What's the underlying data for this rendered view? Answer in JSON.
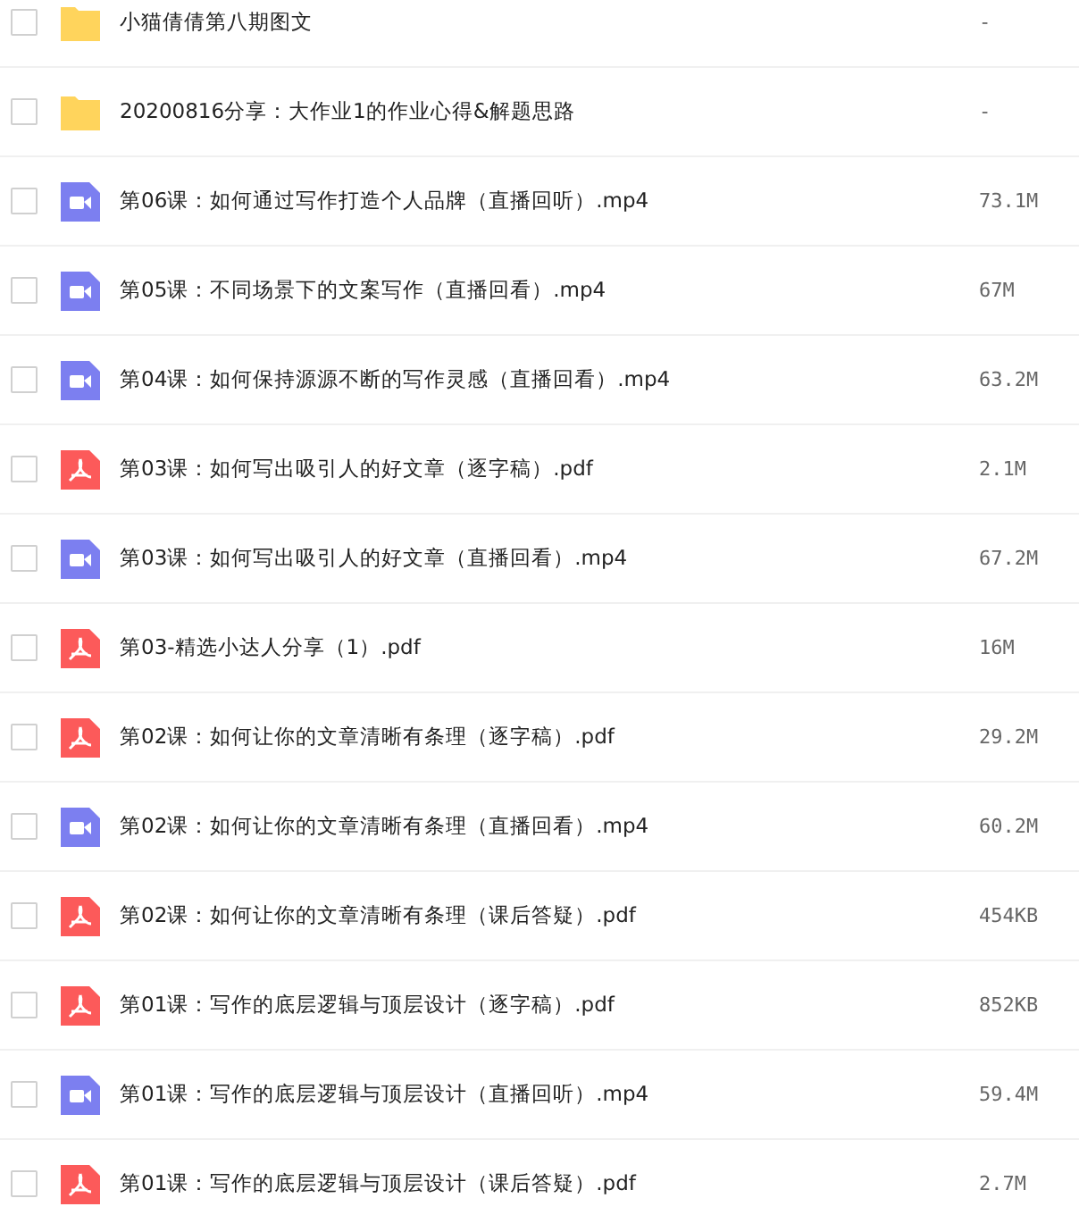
{
  "files": [
    {
      "kind": "folder",
      "name": "小猫倩倩第八期图文",
      "size": "-",
      "checked": false
    },
    {
      "kind": "folder",
      "name": "20200816分享：大作业1的作业心得&解题思路",
      "size": "-",
      "checked": false
    },
    {
      "kind": "video",
      "name": "第06课：如何通过写作打造个人品牌（直播回听）.mp4",
      "size": "73.1M",
      "checked": false
    },
    {
      "kind": "video",
      "name": "第05课：不同场景下的文案写作（直播回看）.mp4",
      "size": "67M",
      "checked": false
    },
    {
      "kind": "video",
      "name": "第04课：如何保持源源不断的写作灵感（直播回看）.mp4",
      "size": "63.2M",
      "checked": false
    },
    {
      "kind": "pdf",
      "name": "第03课：如何写出吸引人的好文章（逐字稿）.pdf",
      "size": "2.1M",
      "checked": false
    },
    {
      "kind": "video",
      "name": "第03课：如何写出吸引人的好文章（直播回看）.mp4",
      "size": "67.2M",
      "checked": false
    },
    {
      "kind": "pdf",
      "name": "第03-精选小达人分享（1）.pdf",
      "size": "16M",
      "checked": false
    },
    {
      "kind": "pdf",
      "name": "第02课：如何让你的文章清晰有条理（逐字稿）.pdf",
      "size": "29.2M",
      "checked": false
    },
    {
      "kind": "video",
      "name": "第02课：如何让你的文章清晰有条理（直播回看）.mp4",
      "size": "60.2M",
      "checked": false
    },
    {
      "kind": "pdf",
      "name": "第02课：如何让你的文章清晰有条理（课后答疑）.pdf",
      "size": "454KB",
      "checked": false
    },
    {
      "kind": "pdf",
      "name": "第01课：写作的底层逻辑与顶层设计（逐字稿）.pdf",
      "size": "852KB",
      "checked": false
    },
    {
      "kind": "video",
      "name": "第01课：写作的底层逻辑与顶层设计（直播回听）.mp4",
      "size": "59.4M",
      "checked": false
    },
    {
      "kind": "pdf",
      "name": "第01课：写作的底层逻辑与顶层设计（课后答疑）.pdf",
      "size": "2.7M",
      "checked": false
    }
  ]
}
